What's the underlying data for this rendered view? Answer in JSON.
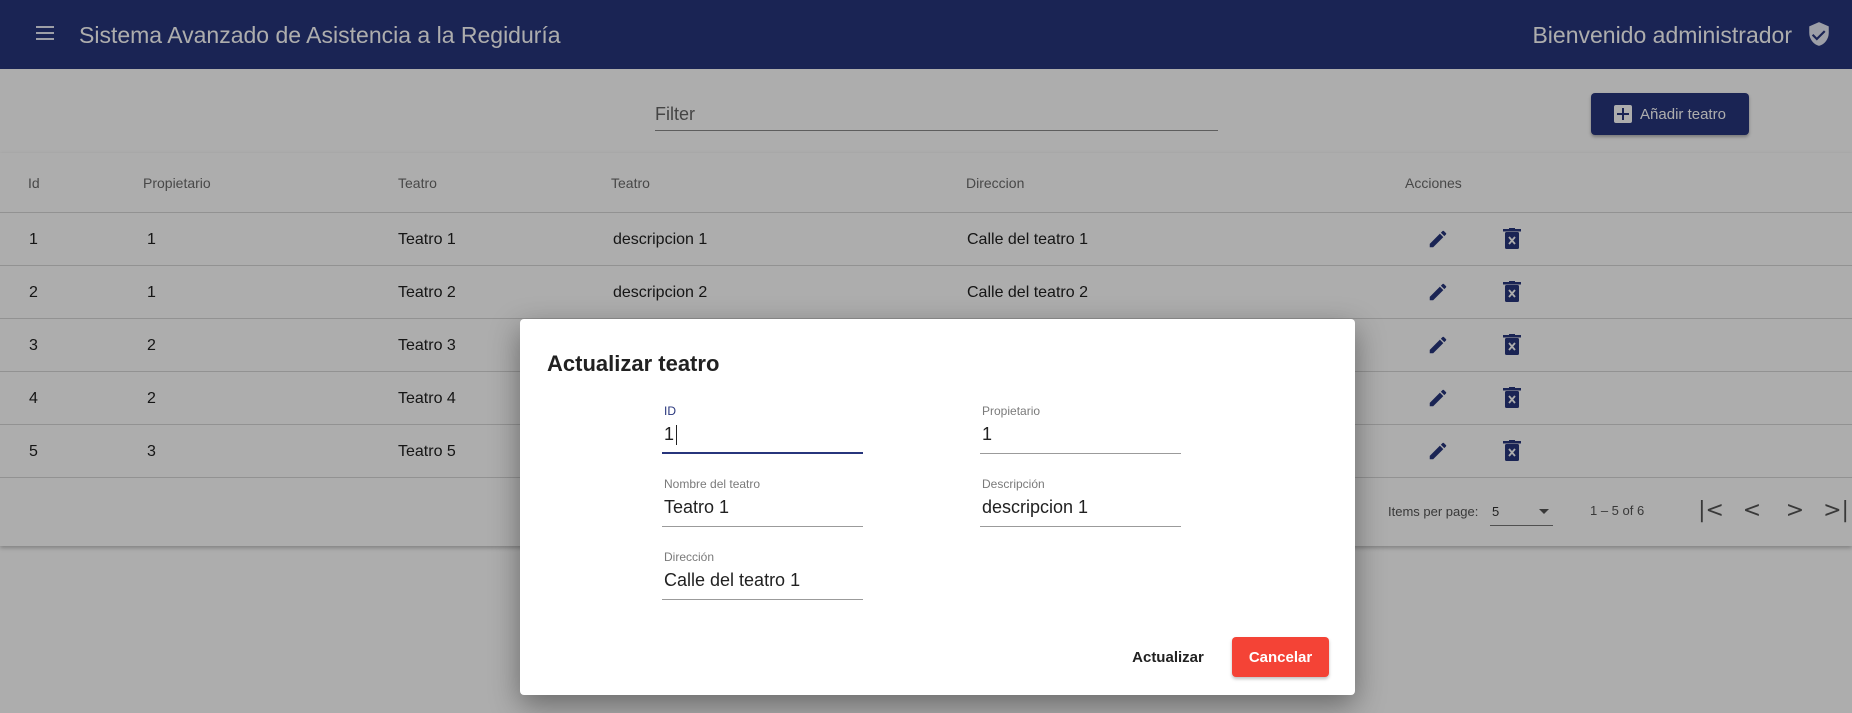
{
  "toolbar": {
    "title": "Sistema Avanzado de Asistencia a la Regiduría",
    "welcome": "Bienvenido administrador"
  },
  "filter": {
    "placeholder": "Filter"
  },
  "add_button": {
    "label": "Añadir teatro"
  },
  "table": {
    "headers": [
      "Id",
      "Propietario",
      "Teatro",
      "Teatro",
      "Direccion",
      "Acciones"
    ],
    "rows": [
      {
        "id": "1",
        "owner": "1",
        "name": "Teatro 1",
        "description": "descripcion 1",
        "address": "Calle del teatro 1"
      },
      {
        "id": "2",
        "owner": "1",
        "name": "Teatro 2",
        "description": "descripcion 2",
        "address": "Calle del teatro 2"
      },
      {
        "id": "3",
        "owner": "2",
        "name": "Teatro 3",
        "description": "",
        "address": ""
      },
      {
        "id": "4",
        "owner": "2",
        "name": "Teatro 4",
        "description": "",
        "address": ""
      },
      {
        "id": "5",
        "owner": "3",
        "name": "Teatro 5",
        "description": "",
        "address": ""
      }
    ]
  },
  "paginator": {
    "items_per_page_label": "Items per page:",
    "page_size": "5",
    "range": "1 – 5 of 6",
    "first": "|<",
    "prev": "<",
    "next": ">",
    "last": ">|"
  },
  "dialog": {
    "title": "Actualizar teatro",
    "fields": {
      "id": {
        "label": "ID",
        "value": "1"
      },
      "owner": {
        "label": "Propietario",
        "value": "1"
      },
      "name": {
        "label": "Nombre del teatro",
        "value": "Teatro 1"
      },
      "description": {
        "label": "Descripción",
        "value": "descripcion 1"
      },
      "address": {
        "label": "Dirección",
        "value": "Calle del teatro 1"
      }
    },
    "update_label": "Actualizar",
    "cancel_label": "Cancelar"
  },
  "colors": {
    "primary": "#27357c",
    "warn": "#f44336"
  }
}
